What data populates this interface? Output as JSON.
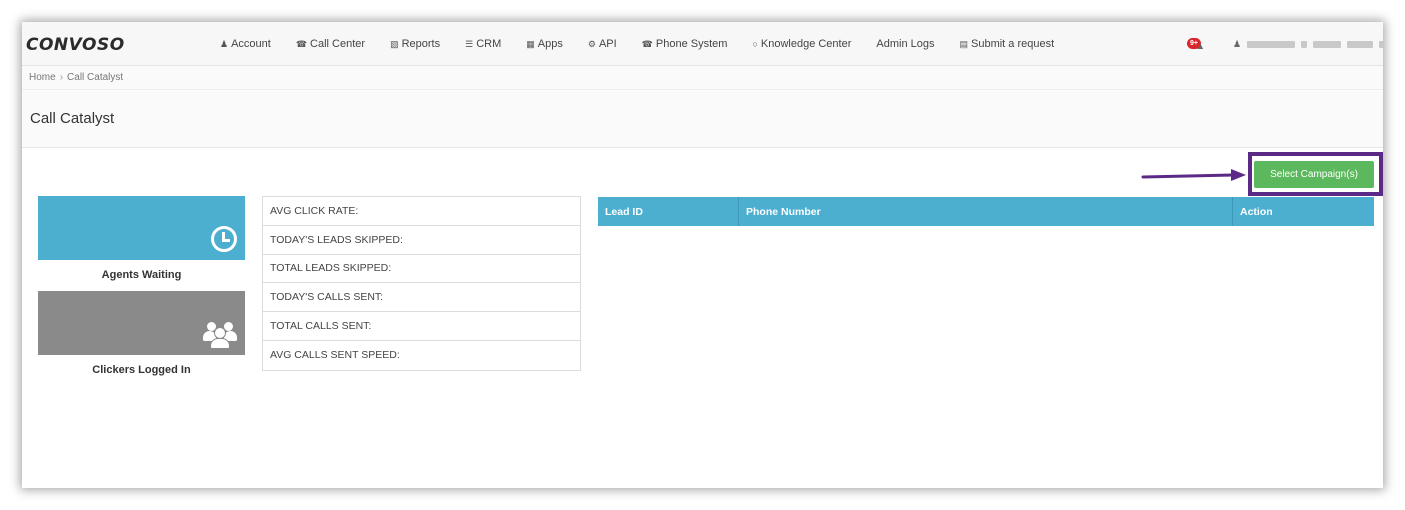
{
  "brand": {
    "logo_text": "CONVOSO"
  },
  "nav": {
    "items": [
      {
        "label": "Account",
        "icon": "user-icon"
      },
      {
        "label": "Call Center",
        "icon": "phone-icon"
      },
      {
        "label": "Reports",
        "icon": "bar-chart-icon"
      },
      {
        "label": "CRM",
        "icon": "list-icon"
      },
      {
        "label": "Apps",
        "icon": "grid-icon"
      },
      {
        "label": "API",
        "icon": "gear-icon"
      },
      {
        "label": "Phone System",
        "icon": "phone-icon"
      },
      {
        "label": "Knowledge Center",
        "icon": "lightbulb-icon"
      },
      {
        "label": "Admin Logs",
        "icon": ""
      },
      {
        "label": "Submit a request",
        "icon": "chat-icon"
      }
    ],
    "notification_badge": "9+"
  },
  "breadcrumb": {
    "home": "Home",
    "current": "Call Catalyst"
  },
  "page": {
    "title": "Call Catalyst"
  },
  "actions": {
    "select_campaigns_label": "Select Campaign(s)"
  },
  "tiles": [
    {
      "label": "Agents Waiting",
      "icon": "clock-icon",
      "color": "#4cafd0"
    },
    {
      "label": "Clickers Logged In",
      "icon": "users-icon",
      "color": "#8a8a8a"
    }
  ],
  "stats": [
    "AVG CLICK RATE:",
    "TODAY'S LEADS SKIPPED:",
    "TOTAL LEADS SKIPPED:",
    "TODAY'S CALLS SENT:",
    "TOTAL CALLS SENT:",
    "AVG CALLS SENT SPEED:"
  ],
  "table": {
    "columns": [
      "Lead ID",
      "Phone Number",
      "Action"
    ],
    "rows": []
  },
  "colors": {
    "accent_blue": "#4cafd0",
    "button_green": "#5cb85c",
    "highlight_purple": "#5b2a86"
  }
}
